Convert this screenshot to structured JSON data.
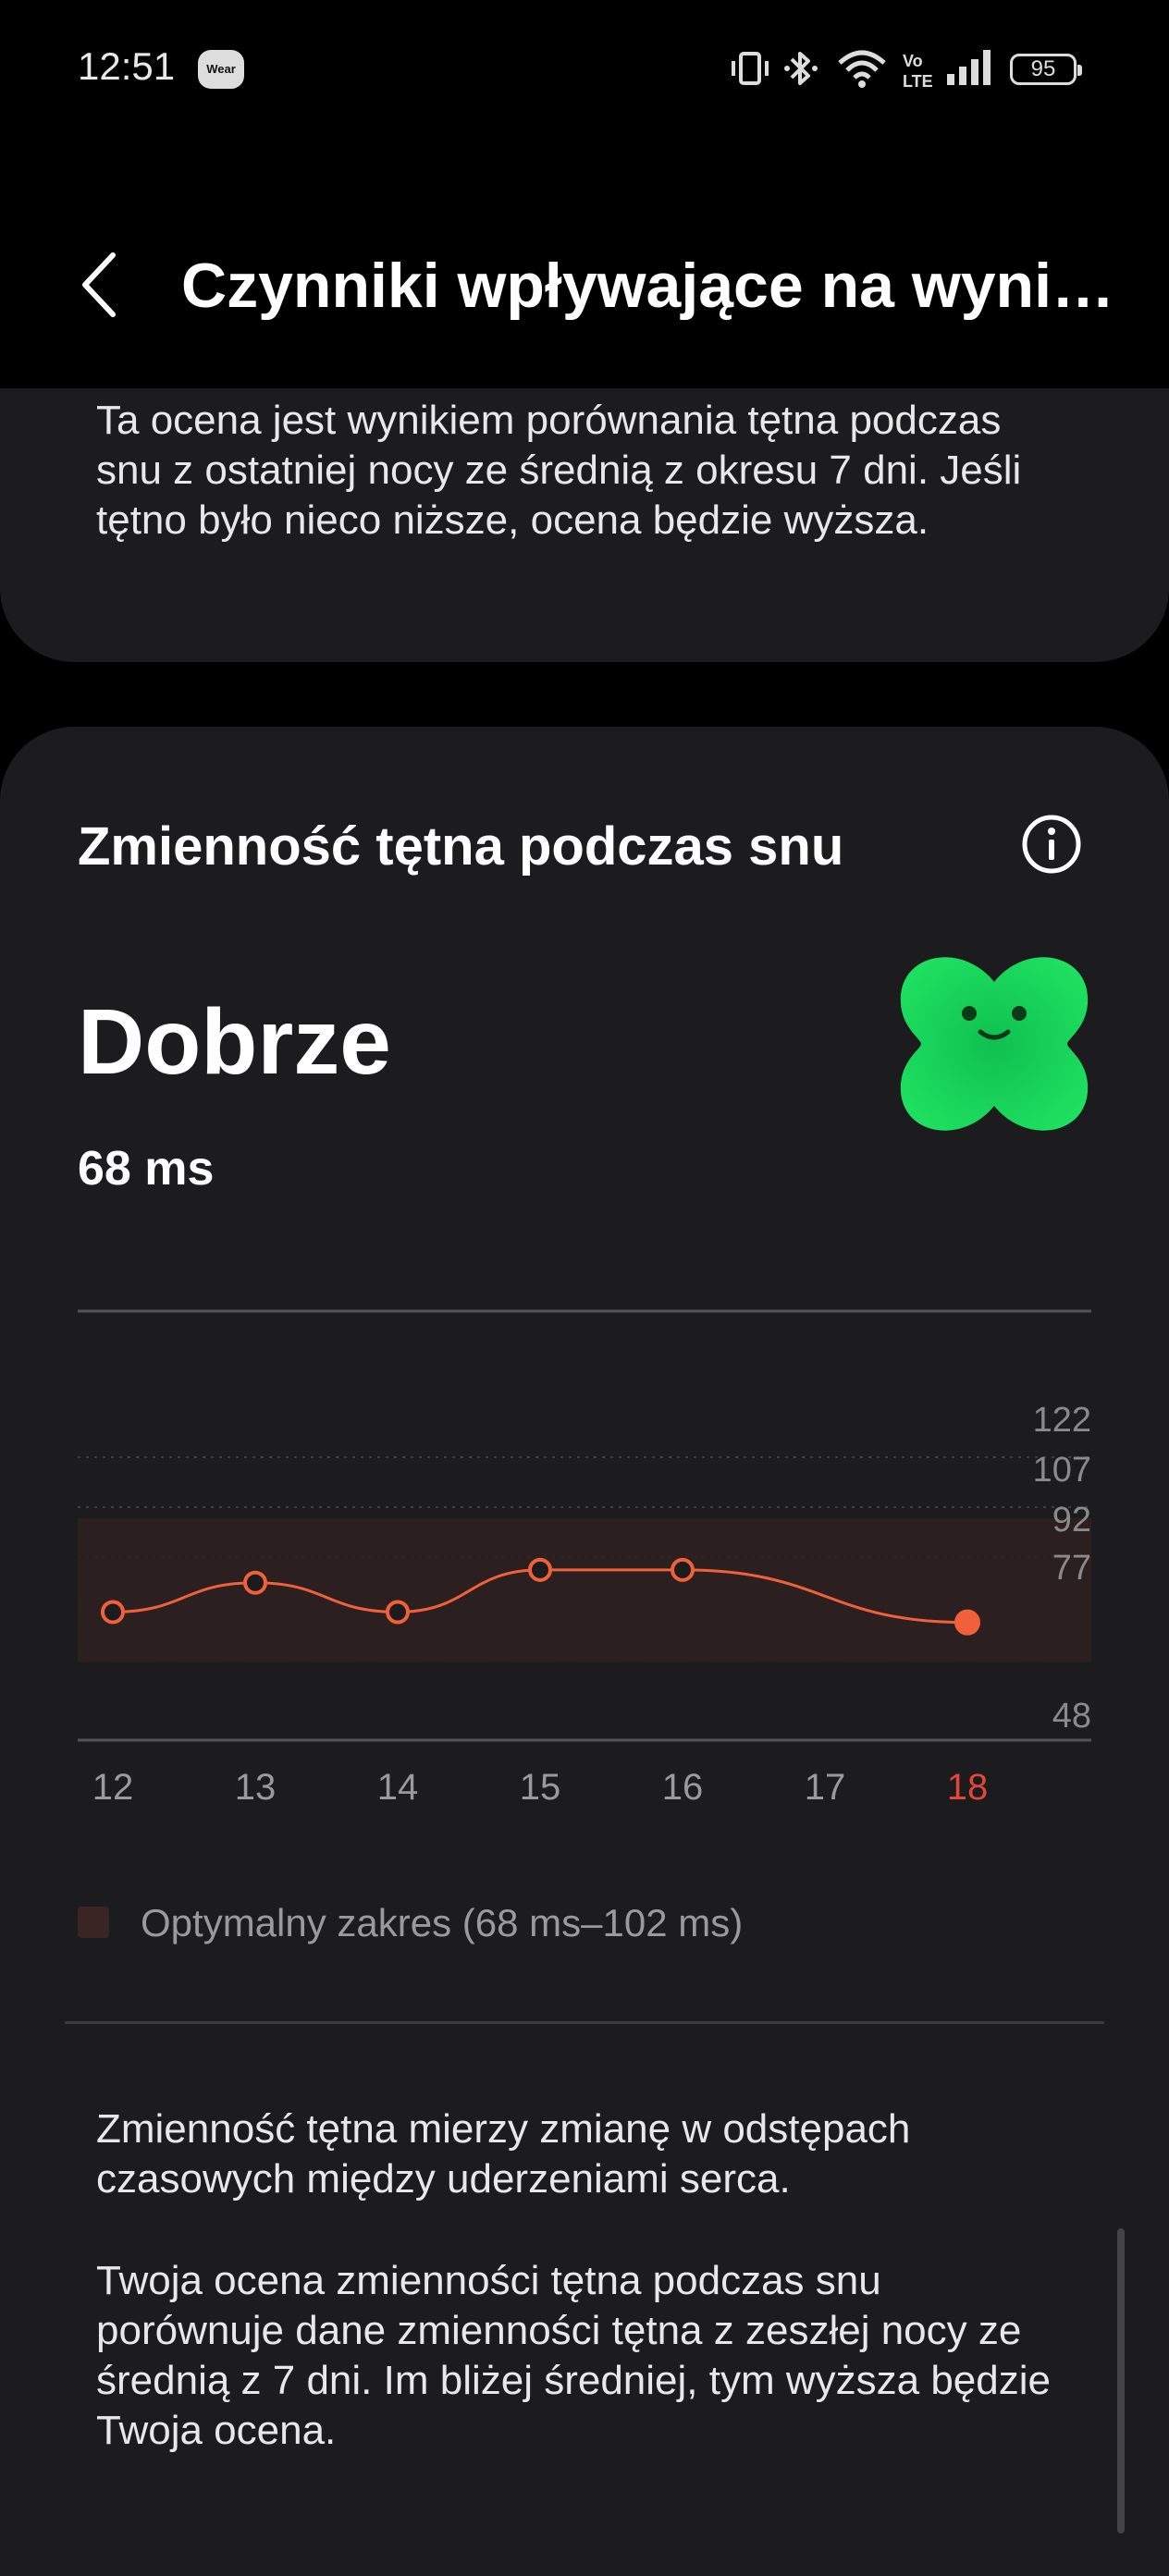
{
  "status_bar": {
    "time": "12:51",
    "wear_badge": "Wear",
    "battery": "95",
    "icons": [
      "vibrate-icon",
      "bluetooth-icon",
      "wifi-icon",
      "volte-icon",
      "signal-icon",
      "battery-icon"
    ]
  },
  "header": {
    "back_icon": "chevron-left-icon",
    "title": "Czynniki wpływające na wynik snu"
  },
  "top_card": {
    "text": "Ta ocena jest wynikiem porównania tętna podczas snu z ostatniej nocy ze średnią z okresu 7 dni. Jeśli tętno było nieco niższe, ocena będzie wyższa."
  },
  "hrv": {
    "title": "Zmienność tętna podczas snu",
    "info_icon": "info-icon",
    "status": "Dobrze",
    "value": "68 ms",
    "mood_icon": "smiling-clover-icon",
    "mood_color": "#1ed760"
  },
  "chart_data": {
    "type": "line",
    "x": [
      "12",
      "13",
      "14",
      "15",
      "16",
      "17",
      "18"
    ],
    "y_ticks": [
      "122",
      "107",
      "92",
      "77",
      "48"
    ],
    "series": [
      {
        "values": [
          75,
          84,
          75,
          88,
          88,
          null,
          72
        ]
      }
    ],
    "highlight_x": "18",
    "optimal_range": [
      68,
      102
    ],
    "legend": "Optymalny zakres (68 ms–102 ms)",
    "colors": {
      "line": "#f0603a",
      "band": "#2d2020",
      "highlight_label": "#e0463a"
    }
  },
  "description": {
    "p1": "Zmienność tętna mierzy zmianę w odstępach czasowych między uderzeniami serca.",
    "p2": "Twoja ocena zmienności tętna podczas snu porównuje dane zmienności tętna z zeszłej nocy ze średnią z 7 dni. Im bliżej średniej, tym wyższa będzie Twoja ocena."
  }
}
